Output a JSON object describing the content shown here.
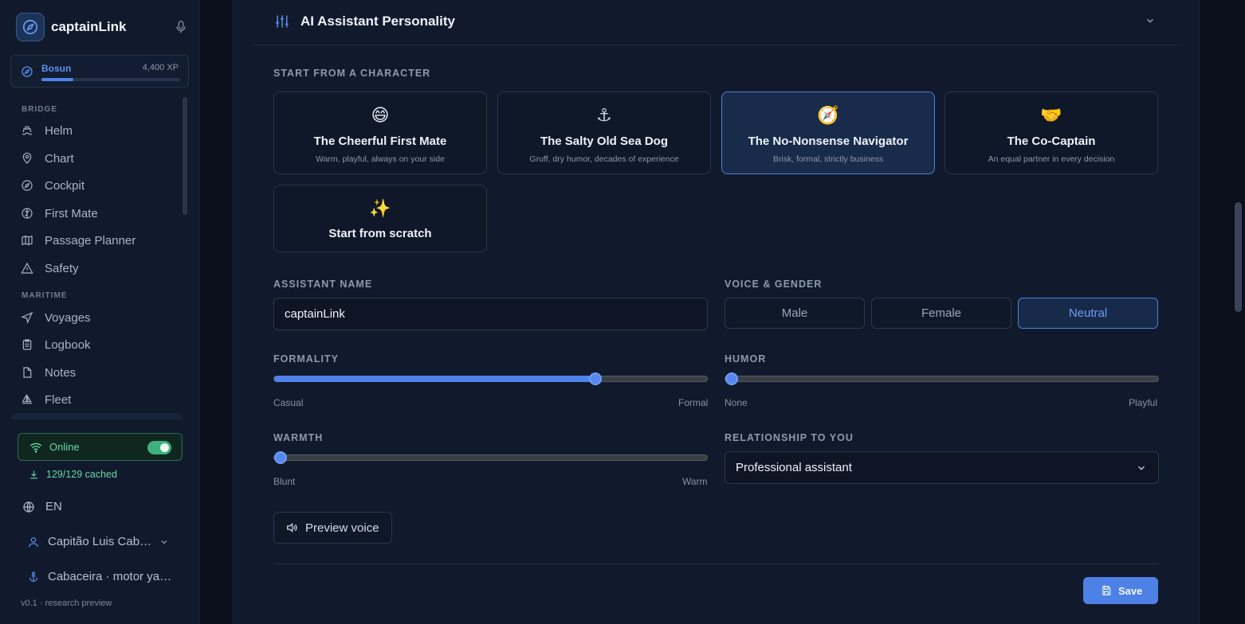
{
  "app": {
    "name": "captainLink",
    "version": "v0.1 · research preview"
  },
  "rank": {
    "name": "Bosun",
    "xp": "4,400 XP",
    "progress": 0.23
  },
  "sidebar": {
    "sections": [
      {
        "label": "BRIDGE",
        "items": [
          {
            "label": "Helm",
            "icon": "ship-wheel-icon"
          },
          {
            "label": "Chart",
            "icon": "map-pin-icon"
          },
          {
            "label": "Cockpit",
            "icon": "compass-icon"
          },
          {
            "label": "First Mate",
            "icon": "brain-icon"
          },
          {
            "label": "Passage Planner",
            "icon": "map-icon"
          },
          {
            "label": "Safety",
            "icon": "warning-icon"
          }
        ]
      },
      {
        "label": "MARITIME",
        "items": [
          {
            "label": "Voyages",
            "icon": "navigation-icon"
          },
          {
            "label": "Logbook",
            "icon": "clipboard-icon"
          },
          {
            "label": "Notes",
            "icon": "file-icon"
          },
          {
            "label": "Fleet",
            "icon": "sailboat-icon"
          }
        ]
      }
    ],
    "status": {
      "online_label": "Online",
      "online_enabled": true,
      "cached": "129/129 cached"
    },
    "language": "EN",
    "user": "Capitão Luis Cabaceira",
    "vessel": "Cabaceira · motor yacht"
  },
  "panel": {
    "title": "AI Assistant Personality",
    "character_label": "START FROM A CHARACTER",
    "characters": [
      {
        "emoji": "😄",
        "title": "The Cheerful First Mate",
        "subtitle": "Warm, playful, always on your side",
        "selected": false
      },
      {
        "emoji": "⚓",
        "title": "The Salty Old Sea Dog",
        "subtitle": "Gruff, dry humor, decades of experience",
        "selected": false
      },
      {
        "emoji": "🧭",
        "title": "The No-Nonsense Navigator",
        "subtitle": "Brisk, formal, strictly business",
        "selected": true
      },
      {
        "emoji": "🤝",
        "title": "The Co-Captain",
        "subtitle": "An equal partner in every decision",
        "selected": false
      },
      {
        "emoji": "✨",
        "title": "Start from scratch",
        "subtitle": "",
        "selected": false
      }
    ],
    "name_label": "ASSISTANT NAME",
    "name_value": "captainLink",
    "voice_label": "VOICE & GENDER",
    "voice_options": [
      "Male",
      "Female",
      "Neutral"
    ],
    "voice_selected": "Neutral",
    "sliders": {
      "formality": {
        "label": "FORMALITY",
        "min_label": "Casual",
        "max_label": "Formal",
        "value": 0.75
      },
      "humor": {
        "label": "HUMOR",
        "min_label": "None",
        "max_label": "Playful",
        "value": 0.0
      },
      "warmth": {
        "label": "WARMTH",
        "min_label": "Blunt",
        "max_label": "Warm",
        "value": 0.0
      }
    },
    "relationship_label": "RELATIONSHIP TO YOU",
    "relationship_value": "Professional assistant",
    "preview_label": "Preview voice",
    "save_label": "Save"
  },
  "colors": {
    "accent": "#4f82ea",
    "online": "#64d8a2",
    "background": "#0b1221"
  }
}
